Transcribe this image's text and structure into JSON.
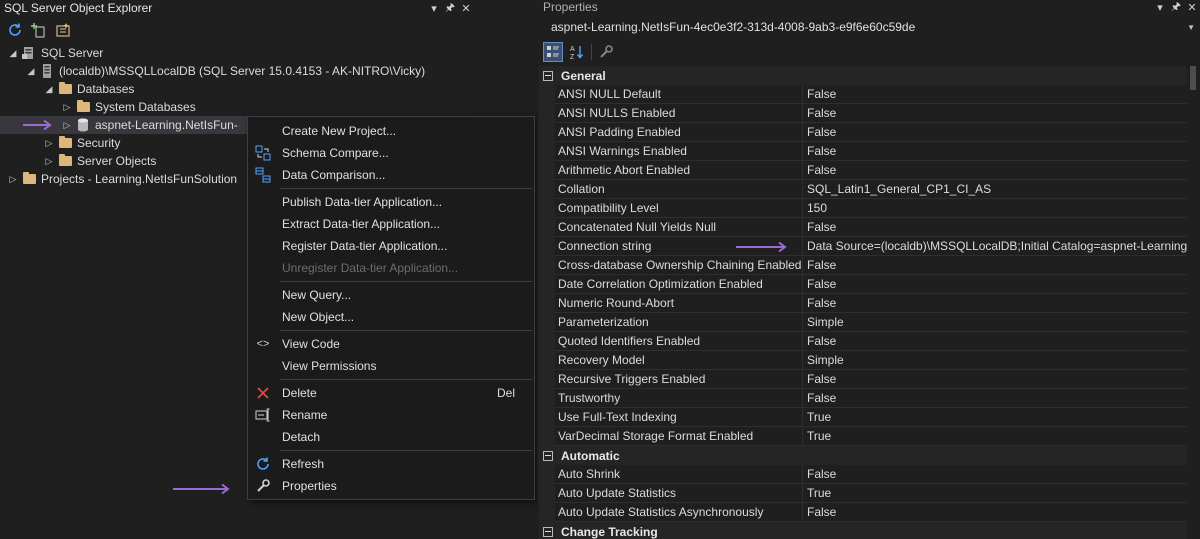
{
  "explorer": {
    "title": "SQL Server Object Explorer",
    "tree": [
      {
        "label": "SQL Server"
      },
      {
        "label": "(localdb)\\MSSQLLocalDB (SQL Server 15.0.4153 - AK-NITRO\\Vicky)"
      },
      {
        "label": "Databases"
      },
      {
        "label": "System Databases"
      },
      {
        "label": "aspnet-Learning.NetIsFun-"
      },
      {
        "label": "Security"
      },
      {
        "label": "Server Objects"
      },
      {
        "label": "Projects - Learning.NetIsFunSolution"
      }
    ]
  },
  "context_menu": {
    "items": [
      {
        "label": "Create New Project...",
        "icon": ""
      },
      {
        "label": "Schema Compare...",
        "icon": "schema-compare-icon"
      },
      {
        "label": "Data Comparison...",
        "icon": "data-compare-icon"
      },
      {
        "label": "Publish Data-tier Application...",
        "icon": ""
      },
      {
        "label": "Extract Data-tier Application...",
        "icon": ""
      },
      {
        "label": "Register Data-tier Application...",
        "icon": ""
      },
      {
        "label": "Unregister Data-tier Application...",
        "icon": "",
        "disabled": true
      },
      {
        "label": "New Query...",
        "icon": ""
      },
      {
        "label": "New Object...",
        "icon": ""
      },
      {
        "label": "View Code",
        "icon": "code-icon"
      },
      {
        "label": "View Permissions",
        "icon": ""
      },
      {
        "label": "Delete",
        "icon": "delete-icon",
        "shortcut": "Del"
      },
      {
        "label": "Rename",
        "icon": "rename-icon"
      },
      {
        "label": "Detach",
        "icon": ""
      },
      {
        "label": "Refresh",
        "icon": "refresh-icon"
      },
      {
        "label": "Properties",
        "icon": "wrench-icon"
      }
    ]
  },
  "properties": {
    "title": "Properties",
    "object": "aspnet-Learning.NetIsFun-4ec0e3f2-313d-4008-9ab3-e9f6e60c59de",
    "categories": [
      {
        "name": "General",
        "rows": [
          {
            "name": "ANSI NULL Default",
            "value": "False"
          },
          {
            "name": "ANSI NULLS Enabled",
            "value": "False"
          },
          {
            "name": "ANSI Padding Enabled",
            "value": "False"
          },
          {
            "name": "ANSI Warnings Enabled",
            "value": "False"
          },
          {
            "name": "Arithmetic Abort Enabled",
            "value": "False"
          },
          {
            "name": "Collation",
            "value": "SQL_Latin1_General_CP1_CI_AS"
          },
          {
            "name": "Compatibility Level",
            "value": "150"
          },
          {
            "name": "Concatenated Null Yields Null",
            "value": "False"
          },
          {
            "name": "Connection string",
            "value": "Data Source=(localdb)\\MSSQLLocalDB;Initial Catalog=aspnet-Learning"
          },
          {
            "name": "Cross-database Ownership Chaining Enabled",
            "value": "False"
          },
          {
            "name": "Date Correlation Optimization Enabled",
            "value": "False"
          },
          {
            "name": "Numeric Round-Abort",
            "value": "False"
          },
          {
            "name": "Parameterization",
            "value": "Simple"
          },
          {
            "name": "Quoted Identifiers Enabled",
            "value": "False"
          },
          {
            "name": "Recovery Model",
            "value": "Simple"
          },
          {
            "name": "Recursive Triggers Enabled",
            "value": "False"
          },
          {
            "name": "Trustworthy",
            "value": "False"
          },
          {
            "name": "Use Full-Text Indexing",
            "value": "True"
          },
          {
            "name": "VarDecimal Storage Format Enabled",
            "value": "True"
          }
        ]
      },
      {
        "name": "Automatic",
        "rows": [
          {
            "name": "Auto Shrink",
            "value": "False"
          },
          {
            "name": "Auto Update Statistics",
            "value": "True"
          },
          {
            "name": "Auto Update Statistics Asynchronously",
            "value": "False"
          }
        ]
      },
      {
        "name": "Change Tracking",
        "rows": []
      }
    ]
  },
  "colors": {
    "accent_arrow": "#9b6bd1",
    "folder": "#dcb67a",
    "delete_icon": "#e04848",
    "refresh_icon": "#4da3ff"
  }
}
